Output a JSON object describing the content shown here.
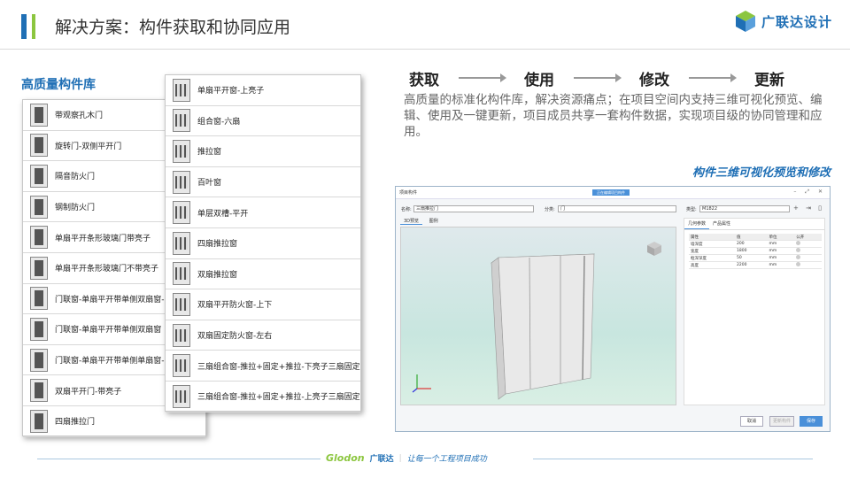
{
  "header": {
    "title": "解决方案：构件获取和协同应用",
    "logo_text": "广联达设计"
  },
  "library": {
    "title": "高质量构件库",
    "list_left": [
      "带观察孔木门",
      "旋转门-双侧平开门",
      "隔音防火门",
      "钢制防火门",
      "单扇平开条形玻璃门带亮子",
      "单扇平开条形玻璃门不带亮子",
      "门联窗-单扇平开带单侧双扇窗-",
      "门联窗-单扇平开带单侧双扇窗",
      "门联窗-单扇平开带单侧单扇窗-",
      "双扇平开门-带亮子",
      "四扇推拉门"
    ],
    "list_right": [
      "单扇平开窗-上亮子",
      "组合窗-六扇",
      "推拉窗",
      "百叶窗",
      "单层双槽-平开",
      "四扇推拉窗",
      "双扇推拉窗",
      "双扇平开防火窗-上下",
      "双扇固定防火窗-左右",
      "三扇组合窗-推拉+固定+推拉-下亮子三扇固定",
      "三扇组合窗-推拉+固定+推拉-上亮子三扇固定"
    ]
  },
  "workflow": {
    "steps": [
      "获取",
      "使用",
      "修改",
      "更新"
    ]
  },
  "description": "高质量的标准化构件库，解决资源痛点；在项目空间内支持三维可视化预览、编辑、使用及一键更新，项目成员共享一套构件数据，实现项目级的协同管理和应用。",
  "preview_caption": "构件三维可视化预览和修改",
  "app": {
    "window_title": "项目构件",
    "center_badge": "正在编辑项目构件",
    "name_label": "名称:",
    "name_value": "三扇推拉门",
    "category_label": "分类:",
    "category_value": "门",
    "type_label": "类型:",
    "type_value": "M1822",
    "view_tabs": [
      "3D预览",
      "图例"
    ],
    "panel_tabs": [
      "几何参数",
      "产品属性"
    ],
    "table_headers": [
      "属性",
      "值",
      "单位",
      "公开"
    ],
    "rows": [
      [
        "墙深度",
        "200",
        "mm"
      ],
      [
        "宽度",
        "1800",
        "mm"
      ],
      [
        "框深深度",
        "50",
        "mm"
      ],
      [
        "高度",
        "2200",
        "mm"
      ]
    ],
    "buttons": {
      "cancel": "取消",
      "update": "更新构件",
      "save": "保存"
    }
  },
  "footer": {
    "brand_a": "Glodon",
    "brand_b": "广联达",
    "slogan": "让每一个工程项目成功"
  },
  "colors": {
    "accent": "#1f6fb5",
    "green": "#8cc63f"
  }
}
